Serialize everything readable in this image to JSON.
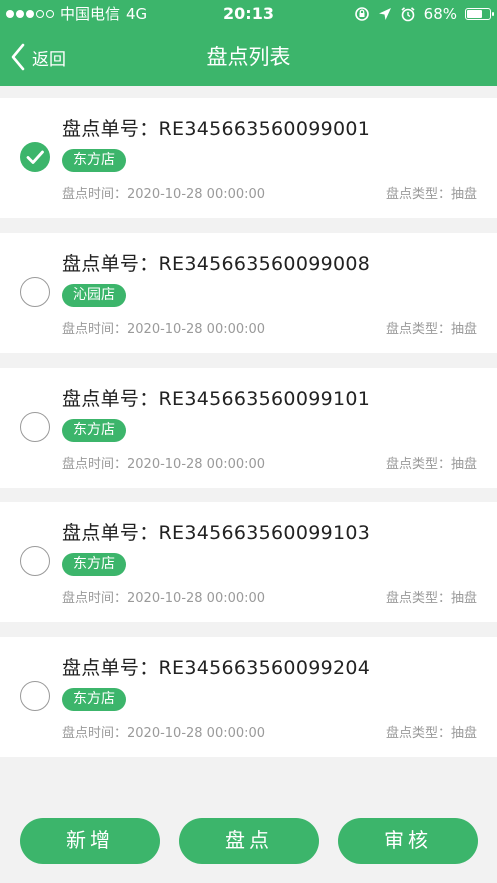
{
  "status_bar": {
    "carrier": "中国电信",
    "network": "4G",
    "time": "20:13",
    "battery": "68%",
    "battery_level": 0.68
  },
  "nav": {
    "back_label": "返回",
    "title": "盘点列表"
  },
  "records": [
    {
      "order_label": "盘点单号：",
      "order_no": "RE345663560099001",
      "store": "东方店",
      "time": "盘点时间：2020-10-28 00:00:00",
      "type": "盘点类型：抽盘",
      "checked": true
    },
    {
      "order_label": "盘点单号：",
      "order_no": "RE345663560099008",
      "store": "沁园店",
      "time": "盘点时间：2020-10-28 00:00:00",
      "type": "盘点类型：抽盘",
      "checked": false
    },
    {
      "order_label": "盘点单号：",
      "order_no": "RE345663560099101",
      "store": "东方店",
      "time": "盘点时间：2020-10-28 00:00:00",
      "type": "盘点类型：抽盘",
      "checked": false
    },
    {
      "order_label": "盘点单号：",
      "order_no": "RE345663560099103",
      "store": "东方店",
      "time": "盘点时间：2020-10-28 00:00:00",
      "type": "盘点类型：抽盘",
      "checked": false
    },
    {
      "order_label": "盘点单号：",
      "order_no": "RE345663560099204",
      "store": "东方店",
      "time": "盘点时间：2020-10-28 00:00:00",
      "type": "盘点类型：抽盘",
      "checked": false
    }
  ],
  "actions": {
    "add_label": "新增",
    "count_label": "盘点",
    "review_label": "审核"
  },
  "colors": {
    "primary": "#3cb56b",
    "background": "#f2f2f2"
  }
}
